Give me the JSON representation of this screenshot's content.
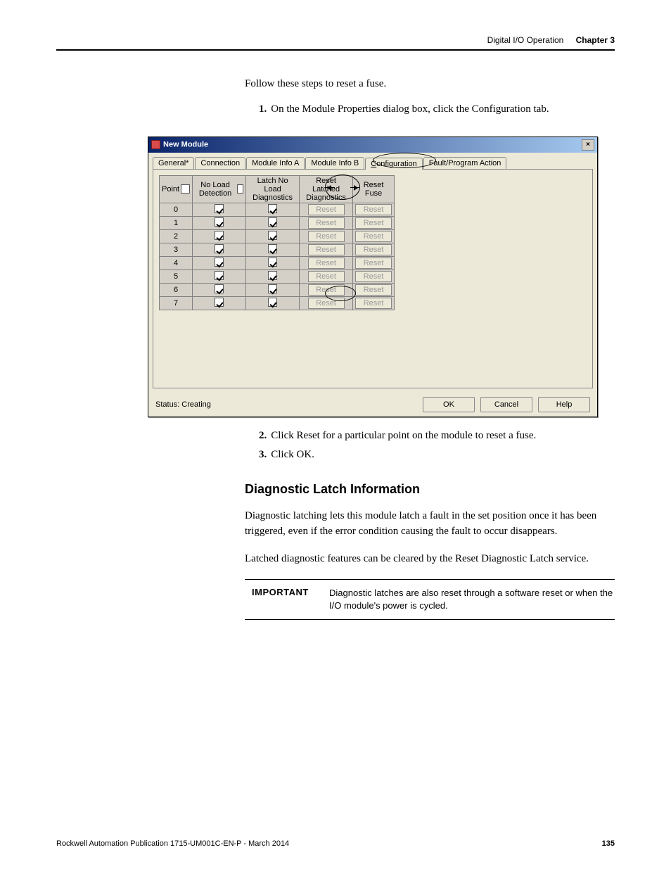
{
  "header": {
    "section": "Digital I/O Operation",
    "chapter_label": "Chapter 3"
  },
  "intro": "Follow these steps to reset a fuse.",
  "steps": [
    {
      "n": "1.",
      "text": "On the Module Properties dialog box, click the Configuration tab."
    },
    {
      "n": "2.",
      "text": "Click Reset for a particular point on the module to reset a fuse."
    },
    {
      "n": "3.",
      "text": "Click OK."
    }
  ],
  "dialog": {
    "title": "New Module",
    "tabs": [
      "General*",
      "Connection",
      "Module Info A",
      "Module Info B",
      "Configuration",
      "Fault/Program Action"
    ],
    "active_tab_index": 4,
    "table": {
      "headers": [
        "Point",
        "No Load Detection",
        "Latch No Load Diagnostics",
        "Reset Latched Diagnostics",
        "Reset Fuse"
      ],
      "rows": [
        {
          "pt": "0",
          "noload": true,
          "latch": true,
          "rl": "Reset",
          "rf": "Reset"
        },
        {
          "pt": "1",
          "noload": true,
          "latch": true,
          "rl": "Reset",
          "rf": "Reset"
        },
        {
          "pt": "2",
          "noload": true,
          "latch": true,
          "rl": "Reset",
          "rf": "Reset"
        },
        {
          "pt": "3",
          "noload": true,
          "latch": true,
          "rl": "Reset",
          "rf": "Reset"
        },
        {
          "pt": "4",
          "noload": true,
          "latch": true,
          "rl": "Reset",
          "rf": "Reset"
        },
        {
          "pt": "5",
          "noload": true,
          "latch": true,
          "rl": "Reset",
          "rf": "Reset"
        },
        {
          "pt": "6",
          "noload": true,
          "latch": true,
          "rl": "Reset",
          "rf": "Reset"
        },
        {
          "pt": "7",
          "noload": true,
          "latch": true,
          "rl": "Reset",
          "rf": "Reset"
        }
      ]
    },
    "status": "Status: Creating",
    "buttons": {
      "ok": "OK",
      "cancel": "Cancel",
      "help": "Help"
    }
  },
  "subsection": {
    "title": "Diagnostic Latch Information",
    "p1": "Diagnostic latching lets this module latch a fault in the set position once it has been triggered, even if the error condition causing the fault to occur disappears.",
    "p2": "Latched diagnostic features can be cleared by the Reset Diagnostic Latch service."
  },
  "important": {
    "label": "IMPORTANT",
    "text": "Diagnostic latches are also reset through a software reset or when the I/O module's power is cycled."
  },
  "footer": {
    "pub": "Rockwell Automation Publication 1715-UM001C-EN-P - March 2014",
    "page": "135"
  }
}
